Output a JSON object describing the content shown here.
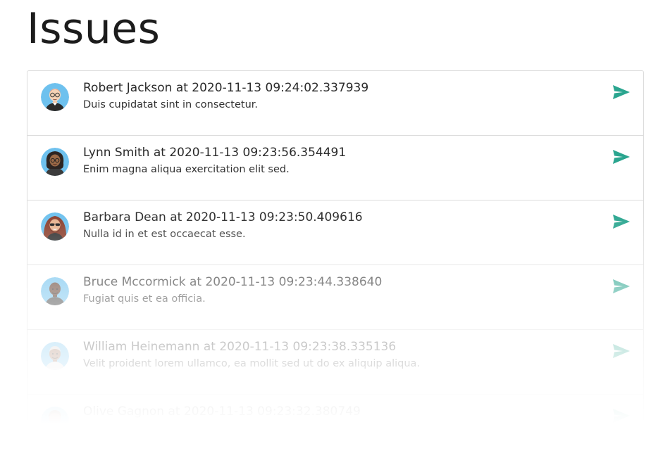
{
  "page": {
    "title": "Issues"
  },
  "colors": {
    "accent": "#2aa58f",
    "avatar_bg": "#6ec1ee",
    "border": "#dcdcdc"
  },
  "issues": [
    {
      "header": "Robert Jackson at 2020-11-13 09:24:02.337939",
      "message": "Duis cupidatat sint in consectetur.",
      "avatar_icon": "avatar-bald-glasses-icon",
      "action_icon": "send-icon"
    },
    {
      "header": "Lynn Smith at 2020-11-13 09:23:56.354491",
      "message": "Enim magna aliqua exercitation elit sed.",
      "avatar_icon": "avatar-curly-hair-glasses-icon",
      "action_icon": "send-icon"
    },
    {
      "header": "Barbara Dean at 2020-11-13 09:23:50.409616",
      "message": "Nulla id in et est occaecat esse.",
      "avatar_icon": "avatar-long-hair-sunglasses-icon",
      "action_icon": "send-icon"
    },
    {
      "header": "Bruce Mccormick at 2020-11-13 09:23:44.338640",
      "message": "Fugiat quis et ea officia.",
      "avatar_icon": "avatar-bald-icon",
      "action_icon": "send-icon"
    },
    {
      "header": "William Heinemann at 2020-11-13 09:23:38.335136",
      "message": "Velit proident lorem ullamco, ea mollit sed ut do ex aliquip aliqua.",
      "avatar_icon": "avatar-grey-hair-icon",
      "action_icon": "send-icon"
    },
    {
      "header": "Olive Gagnon at 2020-11-13 09:23:32.380749",
      "message": "",
      "avatar_icon": "avatar-icon",
      "action_icon": "send-icon"
    }
  ]
}
